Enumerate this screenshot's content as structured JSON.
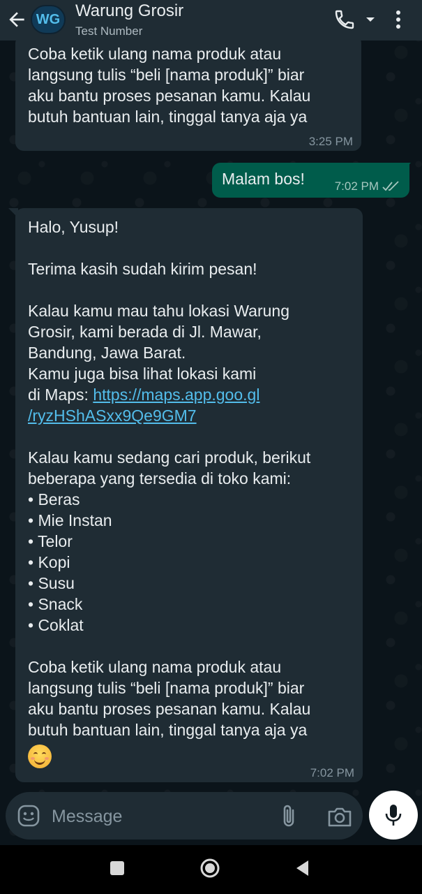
{
  "header": {
    "avatar_initials": "WG",
    "contact_name": "Warung Grosir",
    "contact_subtitle": "Test Number",
    "icons": [
      "back-arrow-icon",
      "phone-icon",
      "caret-down-icon",
      "more-vert-icon"
    ]
  },
  "messages": {
    "top_incoming": {
      "lines": [
        "Coba ketik ulang nama produk atau",
        "langsung tulis “beli [nama produk]” biar",
        "aku bantu proses pesanan kamu. Kalau",
        "butuh bantuan lain, tinggal tanya aja ya"
      ],
      "time": "3:25 PM"
    },
    "outgoing": {
      "text": "Malam bos!",
      "time": "7:02 PM",
      "status": "read"
    },
    "main_incoming": {
      "greeting": "Halo, Yusup!",
      "thanks": "Terima kasih sudah kirim pesan!",
      "location_lines": [
        "Kalau kamu mau tahu lokasi Warung",
        "Grosir, kami berada di Jl. Mawar,",
        "Bandung, Jawa Barat.",
        "Kamu juga bisa lihat lokasi kami"
      ],
      "maps_prefix": "di Maps: ",
      "maps_link_line1": "https://maps.app.goo.gl",
      "maps_link_line2": "/ryzHShASxx9Qe9GM7",
      "products_intro_lines": [
        "Kalau kamu sedang cari produk, berikut",
        "beberapa yang tersedia di toko kami:"
      ],
      "products": [
        "• Beras",
        "• Mie Instan",
        "• Telor",
        "• Kopi",
        "• Susu",
        "• Snack",
        "• Coklat"
      ],
      "closing_lines": [
        "Coba ketik ulang nama produk atau",
        "langsung tulis “beli [nama produk]” biar",
        "aku bantu proses pesanan kamu. Kalau",
        "butuh bantuan lain, tinggal tanya aja ya"
      ],
      "emoji": "smiling-face-emoji",
      "time": "7:02 PM"
    }
  },
  "composer": {
    "placeholder": "Message",
    "icons": [
      "emoji-icon",
      "paperclip-icon",
      "camera-icon",
      "microphone-icon"
    ]
  },
  "colors": {
    "chat_background": "#0b141a",
    "header": "#1f2c34",
    "incoming_bubble": "#1f2c34",
    "outgoing_bubble": "#005c4b",
    "link": "#53bdeb",
    "read_ticks": "#a7c8c0"
  }
}
